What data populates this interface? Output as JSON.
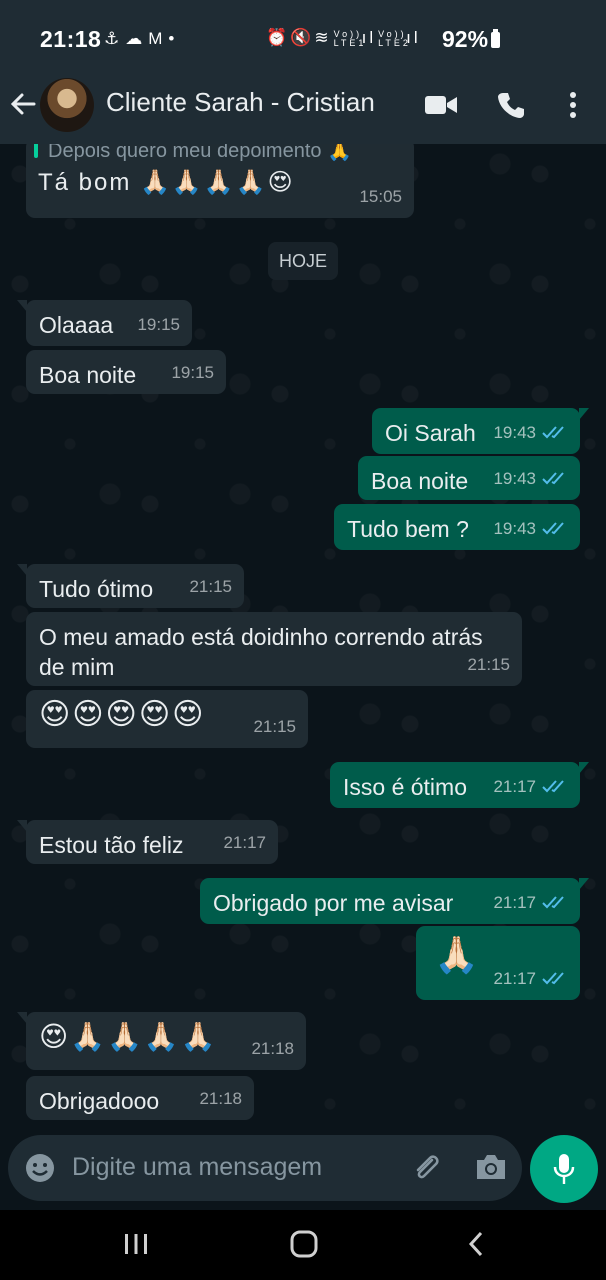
{
  "status_bar": {
    "time": "21:18",
    "lte1": "Vo)) LTE1",
    "lte2": "Vo)) LTE2",
    "battery": "92%"
  },
  "header": {
    "contact_name": "Cliente Sarah - Cristian",
    "icons": [
      "back-arrow-icon",
      "video-call-icon",
      "phone-icon",
      "more-vert-icon"
    ]
  },
  "chat": {
    "quoted_preview": "Depois quero meu depoimento 🙏",
    "date_chip": "HOJE",
    "messages": [
      {
        "dir": "in",
        "text": "Tá bom 🙏🏻🙏🏻🙏🏻🙏🏻😍",
        "time": "15:05"
      },
      {
        "dir": "in",
        "text": "Olaaaa",
        "time": "19:15"
      },
      {
        "dir": "in",
        "text": "Boa noite",
        "time": "19:15"
      },
      {
        "dir": "out",
        "text": "Oi Sarah",
        "time": "19:43"
      },
      {
        "dir": "out",
        "text": "Boa noite",
        "time": "19:43"
      },
      {
        "dir": "out",
        "text": "Tudo bem ?",
        "time": "19:43"
      },
      {
        "dir": "in",
        "text": "Tudo ótimo",
        "time": "21:15"
      },
      {
        "dir": "in",
        "text": "O meu amado está doidinho correndo atrás de mim",
        "time": "21:15"
      },
      {
        "dir": "in",
        "text": "😍😍😍😍😍",
        "time": "21:15"
      },
      {
        "dir": "out",
        "text": "Isso é ótimo",
        "time": "21:17"
      },
      {
        "dir": "in",
        "text": "Estou tão feliz",
        "time": "21:17"
      },
      {
        "dir": "out",
        "text": "Obrigado por me avisar",
        "time": "21:17"
      },
      {
        "dir": "out",
        "text": "🙏🏻",
        "time": "21:17"
      },
      {
        "dir": "in",
        "text": "😍🙏🏻🙏🏻🙏🏻🙏🏻",
        "time": "21:18"
      },
      {
        "dir": "in",
        "text": "Obrigadooo",
        "time": "21:18"
      }
    ]
  },
  "composer": {
    "placeholder": "Digite uma mensagem"
  },
  "colors": {
    "header": "#1f2c34",
    "incoming": "#202c33",
    "outgoing": "#005c4b",
    "accent": "#00a884",
    "read_ticks": "#53bdeb"
  }
}
